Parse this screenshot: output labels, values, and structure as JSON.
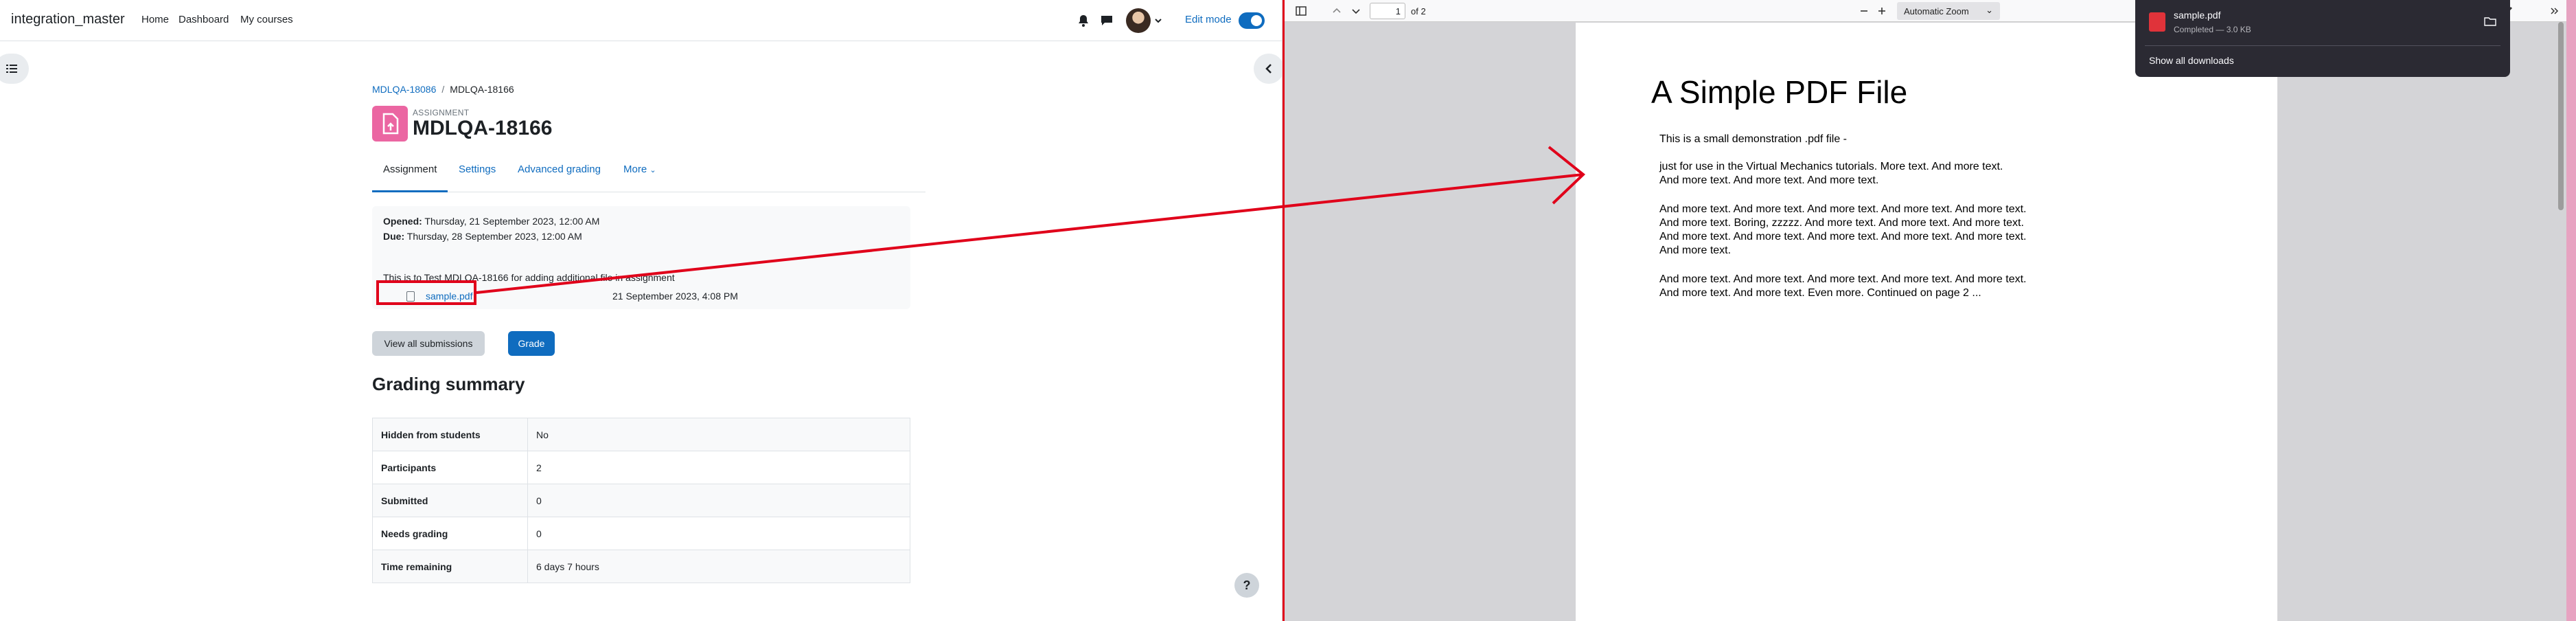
{
  "moodle": {
    "site_name": "integration_master",
    "nav": [
      "Home",
      "Dashboard",
      "My courses"
    ],
    "edit_mode_label": "Edit mode",
    "breadcrumb": [
      "MDLQA-18086",
      "MDLQA-18166"
    ],
    "breadcrumb_sep": "/",
    "activity_type": "ASSIGNMENT",
    "title": "MDLQA-18166",
    "tabs": [
      "Assignment",
      "Settings",
      "Advanced grading",
      "More"
    ],
    "opened_label": "Opened:",
    "opened_value": " Thursday, 21 September 2023, 12:00 AM",
    "due_label": "Due:",
    "due_value": " Thursday, 28 September 2023, 12:00 AM",
    "intro": "This is to Test MDLQA-18166 for adding additional file in assignment",
    "file": {
      "name": "sample.pdf",
      "date": "21 September 2023, 4:08 PM"
    },
    "buttons": {
      "view_all": "View all submissions",
      "grade": "Grade"
    },
    "grading_summary_title": "Grading summary",
    "summary": [
      {
        "label": "Hidden from students",
        "value": "No"
      },
      {
        "label": "Participants",
        "value": "2"
      },
      {
        "label": "Submitted",
        "value": "0"
      },
      {
        "label": "Needs grading",
        "value": "0"
      },
      {
        "label": "Time remaining",
        "value": "6 days 7 hours"
      }
    ],
    "help": "?"
  },
  "pdf_viewer": {
    "page_number": "1",
    "page_count": "of 2",
    "zoom": "Automatic Zoom",
    "title": "A Simple PDF File",
    "lines": [
      "This is a small demonstration .pdf file -",
      "just for use in the Virtual Mechanics tutorials. More text. And more text. And more text. And more text. And more text.",
      "And more text. And more text. And more text. And more text. And more text. And more text. Boring, zzzzz. And more text. And more text. And more text. And more text. And more text. And more text. And more text. And more text. And more text.",
      "And more text. And more text. And more text. And more text. And more text. And more text. And more text. Even more. Continued on page 2 ..."
    ]
  },
  "downloads": {
    "file_name": "sample.pdf",
    "status": "Completed — 3.0 KB",
    "show_all": "Show all downloads"
  },
  "colors": {
    "link": "#0f6cbf",
    "annotation": "#e0001a",
    "pdf_icon": "#e0333a",
    "activity_icon": "#eb66a2"
  }
}
